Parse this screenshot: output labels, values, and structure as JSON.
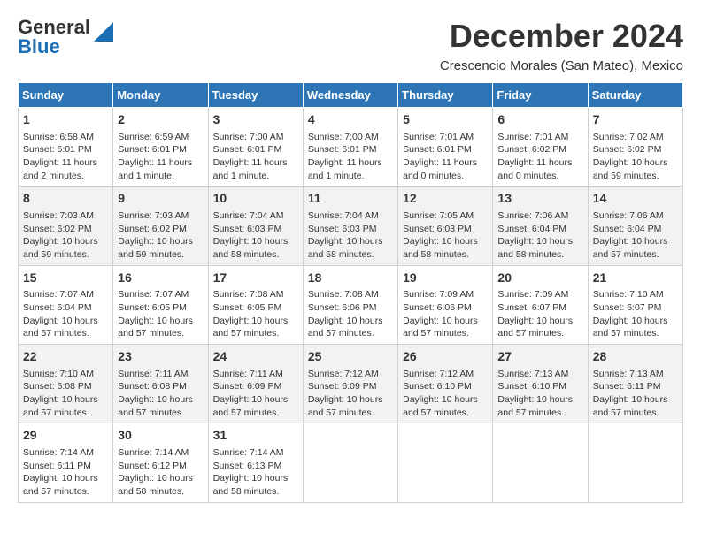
{
  "header": {
    "logo_general": "General",
    "logo_blue": "Blue",
    "month_title": "December 2024",
    "location": "Crescencio Morales (San Mateo), Mexico"
  },
  "calendar": {
    "days_of_week": [
      "Sunday",
      "Monday",
      "Tuesday",
      "Wednesday",
      "Thursday",
      "Friday",
      "Saturday"
    ],
    "weeks": [
      [
        null,
        null,
        null,
        null,
        null,
        null,
        null
      ]
    ]
  },
  "cells": [
    {
      "day": "1",
      "sunrise": "6:58 AM",
      "sunset": "6:01 PM",
      "daylight": "11 hours and 2 minutes."
    },
    {
      "day": "2",
      "sunrise": "6:59 AM",
      "sunset": "6:01 PM",
      "daylight": "11 hours and 1 minute."
    },
    {
      "day": "3",
      "sunrise": "7:00 AM",
      "sunset": "6:01 PM",
      "daylight": "11 hours and 1 minute."
    },
    {
      "day": "4",
      "sunrise": "7:00 AM",
      "sunset": "6:01 PM",
      "daylight": "11 hours and 1 minute."
    },
    {
      "day": "5",
      "sunrise": "7:01 AM",
      "sunset": "6:01 PM",
      "daylight": "11 hours and 0 minutes."
    },
    {
      "day": "6",
      "sunrise": "7:01 AM",
      "sunset": "6:02 PM",
      "daylight": "11 hours and 0 minutes."
    },
    {
      "day": "7",
      "sunrise": "7:02 AM",
      "sunset": "6:02 PM",
      "daylight": "10 hours and 59 minutes."
    },
    {
      "day": "8",
      "sunrise": "7:03 AM",
      "sunset": "6:02 PM",
      "daylight": "10 hours and 59 minutes."
    },
    {
      "day": "9",
      "sunrise": "7:03 AM",
      "sunset": "6:02 PM",
      "daylight": "10 hours and 59 minutes."
    },
    {
      "day": "10",
      "sunrise": "7:04 AM",
      "sunset": "6:03 PM",
      "daylight": "10 hours and 58 minutes."
    },
    {
      "day": "11",
      "sunrise": "7:04 AM",
      "sunset": "6:03 PM",
      "daylight": "10 hours and 58 minutes."
    },
    {
      "day": "12",
      "sunrise": "7:05 AM",
      "sunset": "6:03 PM",
      "daylight": "10 hours and 58 minutes."
    },
    {
      "day": "13",
      "sunrise": "7:06 AM",
      "sunset": "6:04 PM",
      "daylight": "10 hours and 58 minutes."
    },
    {
      "day": "14",
      "sunrise": "7:06 AM",
      "sunset": "6:04 PM",
      "daylight": "10 hours and 57 minutes."
    },
    {
      "day": "15",
      "sunrise": "7:07 AM",
      "sunset": "6:04 PM",
      "daylight": "10 hours and 57 minutes."
    },
    {
      "day": "16",
      "sunrise": "7:07 AM",
      "sunset": "6:05 PM",
      "daylight": "10 hours and 57 minutes."
    },
    {
      "day": "17",
      "sunrise": "7:08 AM",
      "sunset": "6:05 PM",
      "daylight": "10 hours and 57 minutes."
    },
    {
      "day": "18",
      "sunrise": "7:08 AM",
      "sunset": "6:06 PM",
      "daylight": "10 hours and 57 minutes."
    },
    {
      "day": "19",
      "sunrise": "7:09 AM",
      "sunset": "6:06 PM",
      "daylight": "10 hours and 57 minutes."
    },
    {
      "day": "20",
      "sunrise": "7:09 AM",
      "sunset": "6:07 PM",
      "daylight": "10 hours and 57 minutes."
    },
    {
      "day": "21",
      "sunrise": "7:10 AM",
      "sunset": "6:07 PM",
      "daylight": "10 hours and 57 minutes."
    },
    {
      "day": "22",
      "sunrise": "7:10 AM",
      "sunset": "6:08 PM",
      "daylight": "10 hours and 57 minutes."
    },
    {
      "day": "23",
      "sunrise": "7:11 AM",
      "sunset": "6:08 PM",
      "daylight": "10 hours and 57 minutes."
    },
    {
      "day": "24",
      "sunrise": "7:11 AM",
      "sunset": "6:09 PM",
      "daylight": "10 hours and 57 minutes."
    },
    {
      "day": "25",
      "sunrise": "7:12 AM",
      "sunset": "6:09 PM",
      "daylight": "10 hours and 57 minutes."
    },
    {
      "day": "26",
      "sunrise": "7:12 AM",
      "sunset": "6:10 PM",
      "daylight": "10 hours and 57 minutes."
    },
    {
      "day": "27",
      "sunrise": "7:13 AM",
      "sunset": "6:10 PM",
      "daylight": "10 hours and 57 minutes."
    },
    {
      "day": "28",
      "sunrise": "7:13 AM",
      "sunset": "6:11 PM",
      "daylight": "10 hours and 57 minutes."
    },
    {
      "day": "29",
      "sunrise": "7:14 AM",
      "sunset": "6:11 PM",
      "daylight": "10 hours and 57 minutes."
    },
    {
      "day": "30",
      "sunrise": "7:14 AM",
      "sunset": "6:12 PM",
      "daylight": "10 hours and 58 minutes."
    },
    {
      "day": "31",
      "sunrise": "7:14 AM",
      "sunset": "6:13 PM",
      "daylight": "10 hours and 58 minutes."
    }
  ],
  "labels": {
    "sunrise_prefix": "Sunrise: ",
    "sunset_prefix": "Sunset: ",
    "daylight_prefix": "Daylight: "
  }
}
